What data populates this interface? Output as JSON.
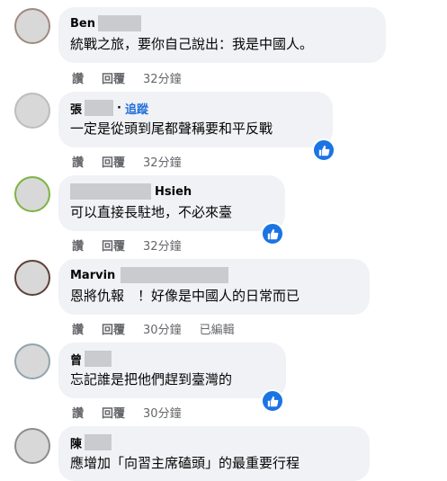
{
  "actions": {
    "like": "讚",
    "reply": "回覆"
  },
  "comments": [
    {
      "name": "Ben",
      "text": "統戰之旅，要你自己說出：我是中國人。",
      "time": "32分鐘"
    },
    {
      "name": "張",
      "follow": "追蹤",
      "text": "一定是從頭到尾都聲稱要和平反戰",
      "time": "32分鐘"
    },
    {
      "name": "Hsieh",
      "text": "可以直接長駐地，不必來臺",
      "time": "32分鐘"
    },
    {
      "name": "Marvin",
      "text": "恩將仇報　！好像是中國人的日常而已",
      "time": "30分鐘",
      "edited": "已編輯"
    },
    {
      "name": "曾",
      "text": "忘記誰是把他們趕到臺灣的",
      "time": "30分鐘"
    },
    {
      "name": "陳",
      "text": "應增加「向習主席磕頭」的最重要行程"
    }
  ],
  "colors": {
    "bubble": "#f0f2f5",
    "meta": "#65676b",
    "link": "#216fdb",
    "like": "#1b74e4"
  },
  "icons": {
    "reaction": "thumbs-up-icon"
  }
}
